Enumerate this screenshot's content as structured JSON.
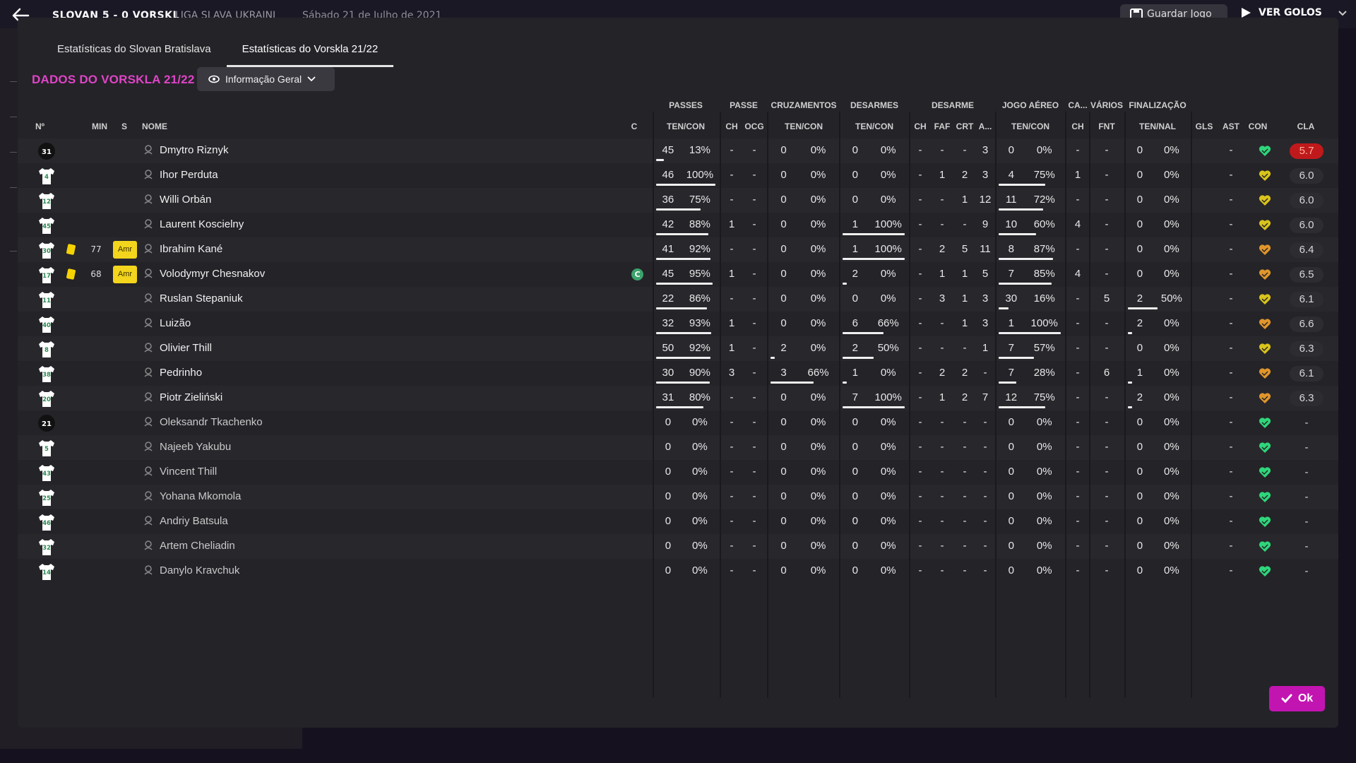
{
  "topbar": {
    "match_title": "SLOVAN 5 - 0 VORSKL",
    "league": "LIGA SLAVA UKRAINI",
    "date": "Sábado 21 de Julho de 2021",
    "save_label": "Guardar Jogo",
    "see_colors_label": "VER GOLOS"
  },
  "tabs": [
    "Estatísticas do Slovan Bratislava",
    "Estatísticas do Vorskla 21/22"
  ],
  "section_title": "DADOS DO VORSKLA 21/22",
  "dropdown": {
    "label": "Informação Geral"
  },
  "groups": {
    "passes": "PASSES",
    "passe": "PASSE",
    "cruzamentos": "CRUZAMENTOS",
    "desarmes": "DESARMES",
    "desarme": "DESARME",
    "jogo_aereo": "JOGO AÉREO",
    "ca": "CA...",
    "varios": "VÁRIOS",
    "finalizacao": "FINALIZAÇÃO"
  },
  "columns": {
    "num": "Nº",
    "min": "MIN",
    "s": "S",
    "nome": "NOME",
    "c": "C",
    "passes_tc": "TEN/CON",
    "passe_ch": "CH",
    "passe_ocg": "OCG",
    "cruz_tc": "TEN/CON",
    "des_tc": "TEN/CON",
    "d_ch": "CH",
    "d_faf": "FAF",
    "d_crt": "CRT",
    "d_a": "A...",
    "aer_tc": "TEN/CON",
    "ca_ch": "CH",
    "var_fnt": "FNT",
    "fin_tn": "TEN/NAL",
    "gls": "GLS",
    "ast": "AST",
    "con": "CON",
    "cla": "CLA"
  },
  "rows": [
    {
      "num": "31",
      "shirt": "dark",
      "name": "Dmytro Riznyk",
      "played": true,
      "min": "",
      "amr": false,
      "captain": false,
      "p": [
        "45",
        "13%",
        0.13
      ],
      "pch": "-",
      "pocg": "-",
      "cr": [
        "0",
        "0%",
        0
      ],
      "de": [
        "0",
        "0%",
        0
      ],
      "dch": "-",
      "faf": "-",
      "crt": "-",
      "a": "3",
      "ae": [
        "0",
        "0%",
        0
      ],
      "cach": "-",
      "fnt": "-",
      "fi": [
        "0",
        "0%",
        0
      ],
      "gls": "",
      "ast": "-",
      "heart": "green",
      "cla": "5.7",
      "cla_style": "red"
    },
    {
      "num": "4",
      "shirt": "white",
      "name": "Ihor Perduta",
      "played": true,
      "min": "",
      "amr": false,
      "captain": false,
      "p": [
        "46",
        "100%",
        1
      ],
      "pch": "-",
      "pocg": "-",
      "cr": [
        "0",
        "0%",
        0
      ],
      "de": [
        "0",
        "0%",
        0
      ],
      "dch": "-",
      "faf": "1",
      "crt": "2",
      "a": "3",
      "ae": [
        "4",
        "75%",
        0.75
      ],
      "cach": "1",
      "fnt": "-",
      "fi": [
        "0",
        "0%",
        0
      ],
      "gls": "",
      "ast": "-",
      "heart": "yellow",
      "cla": "6.0",
      "cla_style": "grey"
    },
    {
      "num": "12",
      "shirt": "white",
      "name": "Willi Orbán",
      "played": true,
      "min": "",
      "amr": false,
      "captain": false,
      "p": [
        "36",
        "75%",
        0.75
      ],
      "pch": "-",
      "pocg": "-",
      "cr": [
        "0",
        "0%",
        0
      ],
      "de": [
        "0",
        "0%",
        0
      ],
      "dch": "-",
      "faf": "-",
      "crt": "1",
      "a": "12",
      "ae": [
        "11",
        "72%",
        0.72
      ],
      "cach": "-",
      "fnt": "-",
      "fi": [
        "0",
        "0%",
        0
      ],
      "gls": "",
      "ast": "-",
      "heart": "yellow",
      "cla": "6.0",
      "cla_style": "grey"
    },
    {
      "num": "45",
      "shirt": "white",
      "name": "Laurent Koscielny",
      "played": true,
      "min": "",
      "amr": false,
      "captain": false,
      "p": [
        "42",
        "88%",
        0.88
      ],
      "pch": "1",
      "pocg": "-",
      "cr": [
        "0",
        "0%",
        0
      ],
      "de": [
        "1",
        "100%",
        1
      ],
      "dch": "-",
      "faf": "-",
      "crt": "-",
      "a": "9",
      "ae": [
        "10",
        "60%",
        0.6
      ],
      "cach": "4",
      "fnt": "-",
      "fi": [
        "0",
        "0%",
        0
      ],
      "gls": "",
      "ast": "-",
      "heart": "yellow",
      "cla": "6.0",
      "cla_style": "grey"
    },
    {
      "num": "30",
      "shirt": "white",
      "name": "Ibrahim Kané",
      "played": true,
      "min": "77",
      "card": true,
      "amr": true,
      "captain": false,
      "p": [
        "41",
        "92%",
        0.92
      ],
      "pch": "-",
      "pocg": "-",
      "cr": [
        "0",
        "0%",
        0
      ],
      "de": [
        "1",
        "100%",
        1
      ],
      "dch": "-",
      "faf": "2",
      "crt": "5",
      "a": "11",
      "ae": [
        "8",
        "87%",
        0.87
      ],
      "cach": "-",
      "fnt": "-",
      "fi": [
        "0",
        "0%",
        0
      ],
      "gls": "",
      "ast": "-",
      "heart": "orange",
      "cla": "6.4",
      "cla_style": "grey"
    },
    {
      "num": "17",
      "shirt": "white",
      "name": "Volodymyr Chesnakov",
      "played": true,
      "min": "68",
      "card": true,
      "amr": true,
      "captain": true,
      "p": [
        "45",
        "95%",
        0.95
      ],
      "pch": "1",
      "pocg": "-",
      "cr": [
        "0",
        "0%",
        0
      ],
      "de": [
        "2",
        "0%",
        0
      ],
      "dch": "-",
      "faf": "1",
      "crt": "1",
      "a": "5",
      "ae": [
        "7",
        "85%",
        0.85
      ],
      "cach": "4",
      "fnt": "-",
      "fi": [
        "0",
        "0%",
        0
      ],
      "gls": "",
      "ast": "-",
      "heart": "orange",
      "cla": "6.5",
      "cla_style": "grey"
    },
    {
      "num": "11",
      "shirt": "white",
      "name": "Ruslan Stepaniuk",
      "played": true,
      "min": "",
      "amr": false,
      "captain": false,
      "p": [
        "22",
        "86%",
        0.86
      ],
      "pch": "-",
      "pocg": "-",
      "cr": [
        "0",
        "0%",
        0
      ],
      "de": [
        "0",
        "0%",
        0
      ],
      "dch": "-",
      "faf": "3",
      "crt": "1",
      "a": "3",
      "ae": [
        "30",
        "16%",
        0.16
      ],
      "cach": "-",
      "fnt": "5",
      "fi": [
        "2",
        "50%",
        0.5
      ],
      "gls": "",
      "ast": "-",
      "heart": "yellow",
      "cla": "6.1",
      "cla_style": "grey"
    },
    {
      "num": "40",
      "shirt": "white",
      "name": "Luizão",
      "played": true,
      "min": "",
      "amr": false,
      "captain": false,
      "p": [
        "32",
        "93%",
        0.93
      ],
      "pch": "1",
      "pocg": "-",
      "cr": [
        "0",
        "0%",
        0
      ],
      "de": [
        "6",
        "66%",
        0.66
      ],
      "dch": "-",
      "faf": "-",
      "crt": "1",
      "a": "3",
      "ae": [
        "1",
        "100%",
        1
      ],
      "cach": "-",
      "fnt": "-",
      "fi": [
        "2",
        "0%",
        0
      ],
      "gls": "",
      "ast": "-",
      "heart": "orange",
      "cla": "6.6",
      "cla_style": "grey"
    },
    {
      "num": "8",
      "shirt": "white",
      "name": "Olivier Thill",
      "played": true,
      "min": "",
      "amr": false,
      "captain": false,
      "p": [
        "50",
        "92%",
        0.92
      ],
      "pch": "1",
      "pocg": "-",
      "cr": [
        "2",
        "0%",
        0
      ],
      "de": [
        "2",
        "50%",
        0.5
      ],
      "dch": "-",
      "faf": "-",
      "crt": "-",
      "a": "1",
      "ae": [
        "7",
        "57%",
        0.57
      ],
      "cach": "-",
      "fnt": "-",
      "fi": [
        "0",
        "0%",
        0
      ],
      "gls": "",
      "ast": "-",
      "heart": "yellow",
      "cla": "6.3",
      "cla_style": "grey"
    },
    {
      "num": "38",
      "shirt": "white",
      "name": "Pedrinho",
      "played": true,
      "min": "",
      "amr": false,
      "captain": false,
      "p": [
        "30",
        "90%",
        0.9
      ],
      "pch": "3",
      "pocg": "-",
      "cr": [
        "3",
        "66%",
        0.66
      ],
      "de": [
        "1",
        "0%",
        0
      ],
      "dch": "-",
      "faf": "2",
      "crt": "2",
      "a": "-",
      "ae": [
        "7",
        "28%",
        0.28
      ],
      "cach": "-",
      "fnt": "6",
      "fi": [
        "1",
        "0%",
        0
      ],
      "gls": "",
      "ast": "-",
      "heart": "orange",
      "cla": "6.1",
      "cla_style": "grey"
    },
    {
      "num": "20",
      "shirt": "white",
      "name": "Piotr Zieliński",
      "played": true,
      "min": "",
      "amr": false,
      "captain": false,
      "p": [
        "31",
        "80%",
        0.8
      ],
      "pch": "-",
      "pocg": "-",
      "cr": [
        "0",
        "0%",
        0
      ],
      "de": [
        "7",
        "100%",
        1
      ],
      "dch": "-",
      "faf": "1",
      "crt": "2",
      "a": "7",
      "ae": [
        "12",
        "75%",
        0.75
      ],
      "cach": "-",
      "fnt": "-",
      "fi": [
        "2",
        "0%",
        0
      ],
      "gls": "",
      "ast": "-",
      "heart": "orange",
      "cla": "6.3",
      "cla_style": "grey"
    },
    {
      "num": "21",
      "shirt": "dark",
      "name": "Oleksandr Tkachenko",
      "played": false,
      "min": "",
      "amr": false,
      "captain": false,
      "p": [
        "0",
        "0%",
        0
      ],
      "pch": "-",
      "pocg": "-",
      "cr": [
        "0",
        "0%",
        0
      ],
      "de": [
        "0",
        "0%",
        0
      ],
      "dch": "-",
      "faf": "-",
      "crt": "-",
      "a": "-",
      "ae": [
        "0",
        "0%",
        0
      ],
      "cach": "-",
      "fnt": "-",
      "fi": [
        "0",
        "0%",
        0
      ],
      "gls": "",
      "ast": "-",
      "heart": "green",
      "cla": "-",
      "cla_style": "none"
    },
    {
      "num": "5",
      "shirt": "white",
      "name": "Najeeb Yakubu",
      "played": false,
      "min": "",
      "amr": false,
      "captain": false,
      "p": [
        "0",
        "0%",
        0
      ],
      "pch": "-",
      "pocg": "-",
      "cr": [
        "0",
        "0%",
        0
      ],
      "de": [
        "0",
        "0%",
        0
      ],
      "dch": "-",
      "faf": "-",
      "crt": "-",
      "a": "-",
      "ae": [
        "0",
        "0%",
        0
      ],
      "cach": "-",
      "fnt": "-",
      "fi": [
        "0",
        "0%",
        0
      ],
      "gls": "",
      "ast": "-",
      "heart": "green",
      "cla": "-",
      "cla_style": "none"
    },
    {
      "num": "43",
      "shirt": "white",
      "name": "Vincent Thill",
      "played": false,
      "min": "",
      "amr": false,
      "captain": false,
      "p": [
        "0",
        "0%",
        0
      ],
      "pch": "-",
      "pocg": "-",
      "cr": [
        "0",
        "0%",
        0
      ],
      "de": [
        "0",
        "0%",
        0
      ],
      "dch": "-",
      "faf": "-",
      "crt": "-",
      "a": "-",
      "ae": [
        "0",
        "0%",
        0
      ],
      "cach": "-",
      "fnt": "-",
      "fi": [
        "0",
        "0%",
        0
      ],
      "gls": "",
      "ast": "-",
      "heart": "green",
      "cla": "-",
      "cla_style": "none"
    },
    {
      "num": "25",
      "shirt": "white",
      "name": "Yohana Mkomola",
      "played": false,
      "min": "",
      "amr": false,
      "captain": false,
      "p": [
        "0",
        "0%",
        0
      ],
      "pch": "-",
      "pocg": "-",
      "cr": [
        "0",
        "0%",
        0
      ],
      "de": [
        "0",
        "0%",
        0
      ],
      "dch": "-",
      "faf": "-",
      "crt": "-",
      "a": "-",
      "ae": [
        "0",
        "0%",
        0
      ],
      "cach": "-",
      "fnt": "-",
      "fi": [
        "0",
        "0%",
        0
      ],
      "gls": "",
      "ast": "-",
      "heart": "green",
      "cla": "-",
      "cla_style": "none"
    },
    {
      "num": "46",
      "shirt": "white",
      "name": "Andriy Batsula",
      "played": false,
      "min": "",
      "amr": false,
      "captain": false,
      "p": [
        "0",
        "0%",
        0
      ],
      "pch": "-",
      "pocg": "-",
      "cr": [
        "0",
        "0%",
        0
      ],
      "de": [
        "0",
        "0%",
        0
      ],
      "dch": "-",
      "faf": "-",
      "crt": "-",
      "a": "-",
      "ae": [
        "0",
        "0%",
        0
      ],
      "cach": "-",
      "fnt": "-",
      "fi": [
        "0",
        "0%",
        0
      ],
      "gls": "",
      "ast": "-",
      "heart": "green",
      "cla": "-",
      "cla_style": "none"
    },
    {
      "num": "32",
      "shirt": "white",
      "name": "Artem Cheliadin",
      "played": false,
      "min": "",
      "amr": false,
      "captain": false,
      "p": [
        "0",
        "0%",
        0
      ],
      "pch": "-",
      "pocg": "-",
      "cr": [
        "0",
        "0%",
        0
      ],
      "de": [
        "0",
        "0%",
        0
      ],
      "dch": "-",
      "faf": "-",
      "crt": "-",
      "a": "-",
      "ae": [
        "0",
        "0%",
        0
      ],
      "cach": "-",
      "fnt": "-",
      "fi": [
        "0",
        "0%",
        0
      ],
      "gls": "",
      "ast": "-",
      "heart": "green",
      "cla": "-",
      "cla_style": "none"
    },
    {
      "num": "14",
      "shirt": "white",
      "name": "Danylo Kravchuk",
      "played": false,
      "min": "",
      "amr": false,
      "captain": false,
      "p": [
        "0",
        "0%",
        0
      ],
      "pch": "-",
      "pocg": "-",
      "cr": [
        "0",
        "0%",
        0
      ],
      "de": [
        "0",
        "0%",
        0
      ],
      "dch": "-",
      "faf": "-",
      "crt": "-",
      "a": "-",
      "ae": [
        "0",
        "0%",
        0
      ],
      "cach": "-",
      "fnt": "-",
      "fi": [
        "0",
        "0%",
        0
      ],
      "gls": "",
      "ast": "-",
      "heart": "green",
      "cla": "-",
      "cla_style": "none"
    }
  ],
  "amr_label": "Amr",
  "captain_label": "C",
  "ok_label": "Ok",
  "colors": {
    "accent": "#e044c8",
    "ok_button": "#c214b1",
    "heart_green": "#2ed67a",
    "heart_yellow": "#d9c31c",
    "heart_orange": "#e0952c",
    "rating_red": "#c0191b",
    "card_yellow": "#f5d300"
  }
}
